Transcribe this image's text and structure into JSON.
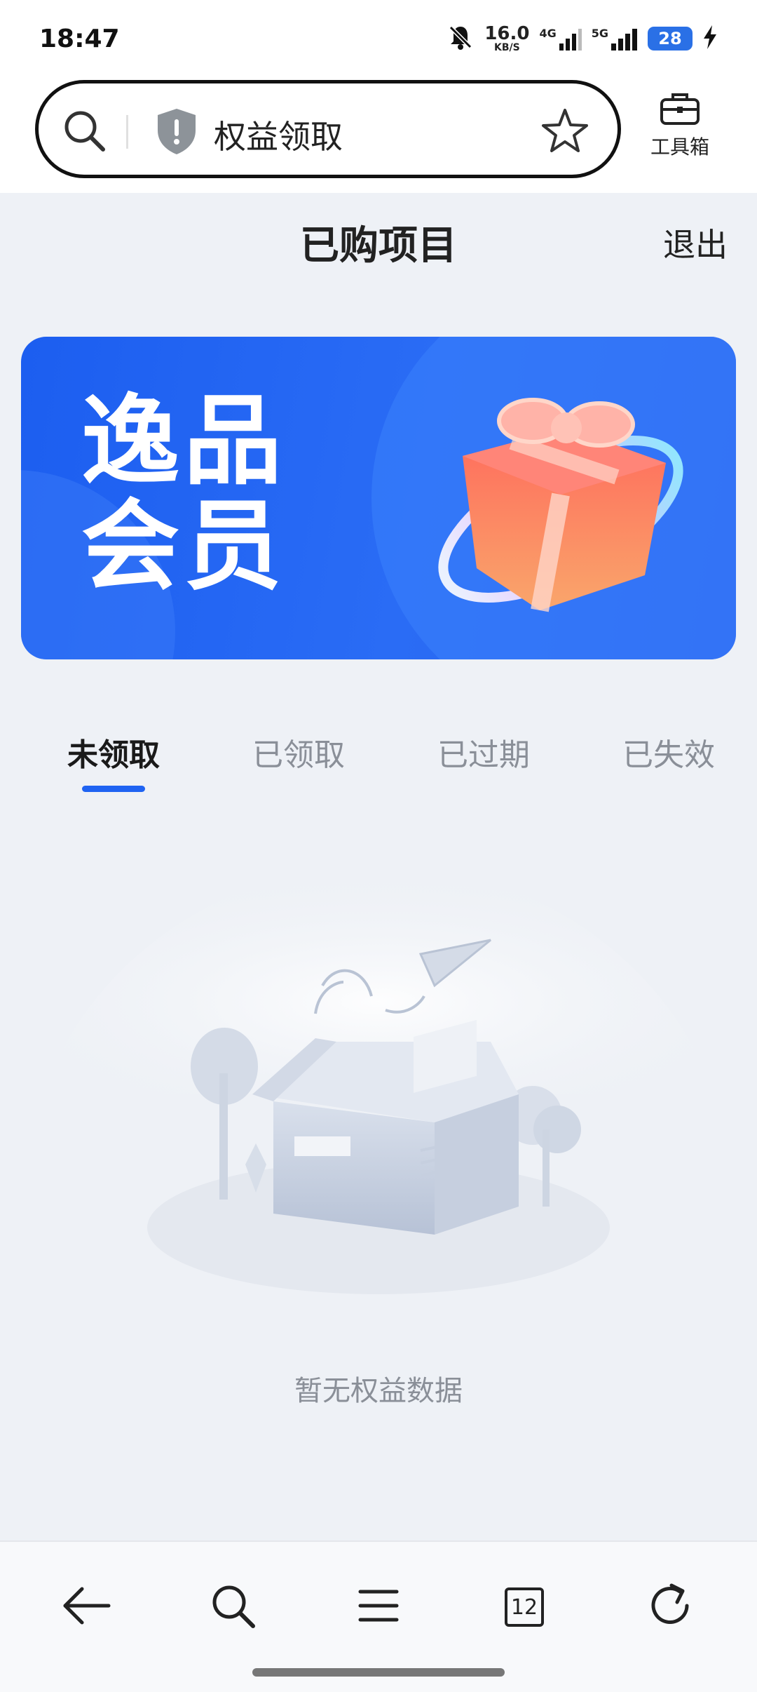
{
  "status_bar": {
    "time": "18:47",
    "net_speed_value": "16.0",
    "net_speed_unit": "KB/S",
    "network_4g": "4G",
    "network_5g": "5G",
    "battery": "28"
  },
  "search_bar": {
    "text": "权益领取"
  },
  "toolbox": {
    "label": "工具箱"
  },
  "page": {
    "title": "已购项目",
    "logout_label": "退出"
  },
  "banner": {
    "line1": "逸品",
    "line2": "会员"
  },
  "tabs": [
    {
      "label": "未领取",
      "active": true
    },
    {
      "label": "已领取",
      "active": false
    },
    {
      "label": "已过期",
      "active": false
    },
    {
      "label": "已失效",
      "active": false
    }
  ],
  "empty_state": {
    "text": "暂无权益数据"
  },
  "bottom_nav": {
    "tab_count": "12"
  },
  "colors": {
    "accent": "#1f63f2",
    "banner": "#1c5ef0",
    "background": "#eef1f6"
  }
}
